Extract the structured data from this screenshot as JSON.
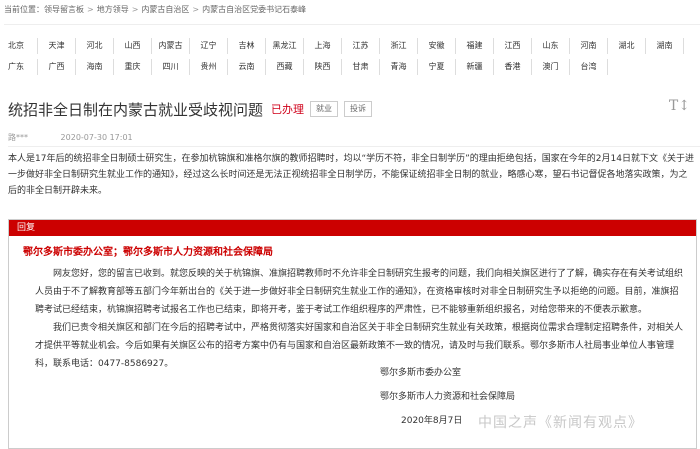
{
  "breadcrumb": {
    "prefix": "当前位置：",
    "items": [
      "领导留言板",
      "地方领导",
      "内蒙古自治区",
      "内蒙古自治区党委书记石泰峰"
    ]
  },
  "regions": {
    "row1": [
      "北京",
      "天津",
      "河北",
      "山西",
      "内蒙古",
      "辽宁",
      "吉林",
      "黑龙江",
      "上海",
      "江苏",
      "浙江",
      "安徽",
      "福建",
      "江西",
      "山东",
      "河南",
      "湖北",
      "湖南"
    ],
    "row2": [
      "广东",
      "广西",
      "海南",
      "重庆",
      "四川",
      "贵州",
      "云南",
      "西藏",
      "陕西",
      "甘肃",
      "青海",
      "宁夏",
      "新疆",
      "香港",
      "澳门",
      "台湾"
    ]
  },
  "message": {
    "title": "统招非全日制在内蒙古就业受歧视问题",
    "status": "已办理",
    "tags": [
      "就业",
      "投诉"
    ],
    "font_toggle": "T↕",
    "author": "路***",
    "date": "2020-07-30 17:01",
    "body": "本人是17年后的统招非全日制硕士研究生，在参加杭锦旗和准格尔旗的教师招聘时，均以“学历不符，非全日制学历”的理由拒绝包括，国家在今年的2月14日就下文《关于进一步做好非全日制研究生就业工作的通知》，经过这么长时间还是无法正视统招非全日制学历，不能保证统招非全日制的就业，略感心寒，望石书记督促各地落实政策，为之后的非全日制开辟未来。"
  },
  "reply": {
    "header": "回复",
    "dept": "鄂尔多斯市委办公室；鄂尔多斯市人力资源和社会保障局",
    "paragraphs": [
      "网友您好，您的留言已收到。就您反映的关于杭锦旗、准旗招聘教师时不允许非全日制研究生报考的问题，我们向相关旗区进行了了解，确实存在有关考试组织人员由于不了解教育部等五部门今年新出台的《关于进一步做好非全日制研究生就业工作的通知》，在资格审核时对非全日制研究生予以拒绝的问题。目前，准旗招聘考试已经结束，杭锦旗招聘考试报名工作也已结束，即将开考，鉴于考试工作组织程序的严肃性，已不能够重新组织报名，对给您带来的不便表示歉意。",
      "我们已责令相关旗区和部门在今后的招聘考试中，严格贯彻落实好国家和自治区关于非全日制研究生就业有关政策，根据岗位需求合理制定招聘条件，对相关人才提供平等就业机会。今后如果有关旗区公布的招考方案中仍有与国家和自治区最新政策不一致的情况，请及时与我们联系。鄂尔多斯市人社局事业单位人事管理科，联系电话：0477-8586927。"
    ],
    "sign_1": "鄂尔多斯市委办公室",
    "sign_2": "鄂尔多斯市人力资源和社会保障局",
    "sign_date": "2020年8月7日"
  },
  "watermark": "中国之声《新闻有观点》"
}
